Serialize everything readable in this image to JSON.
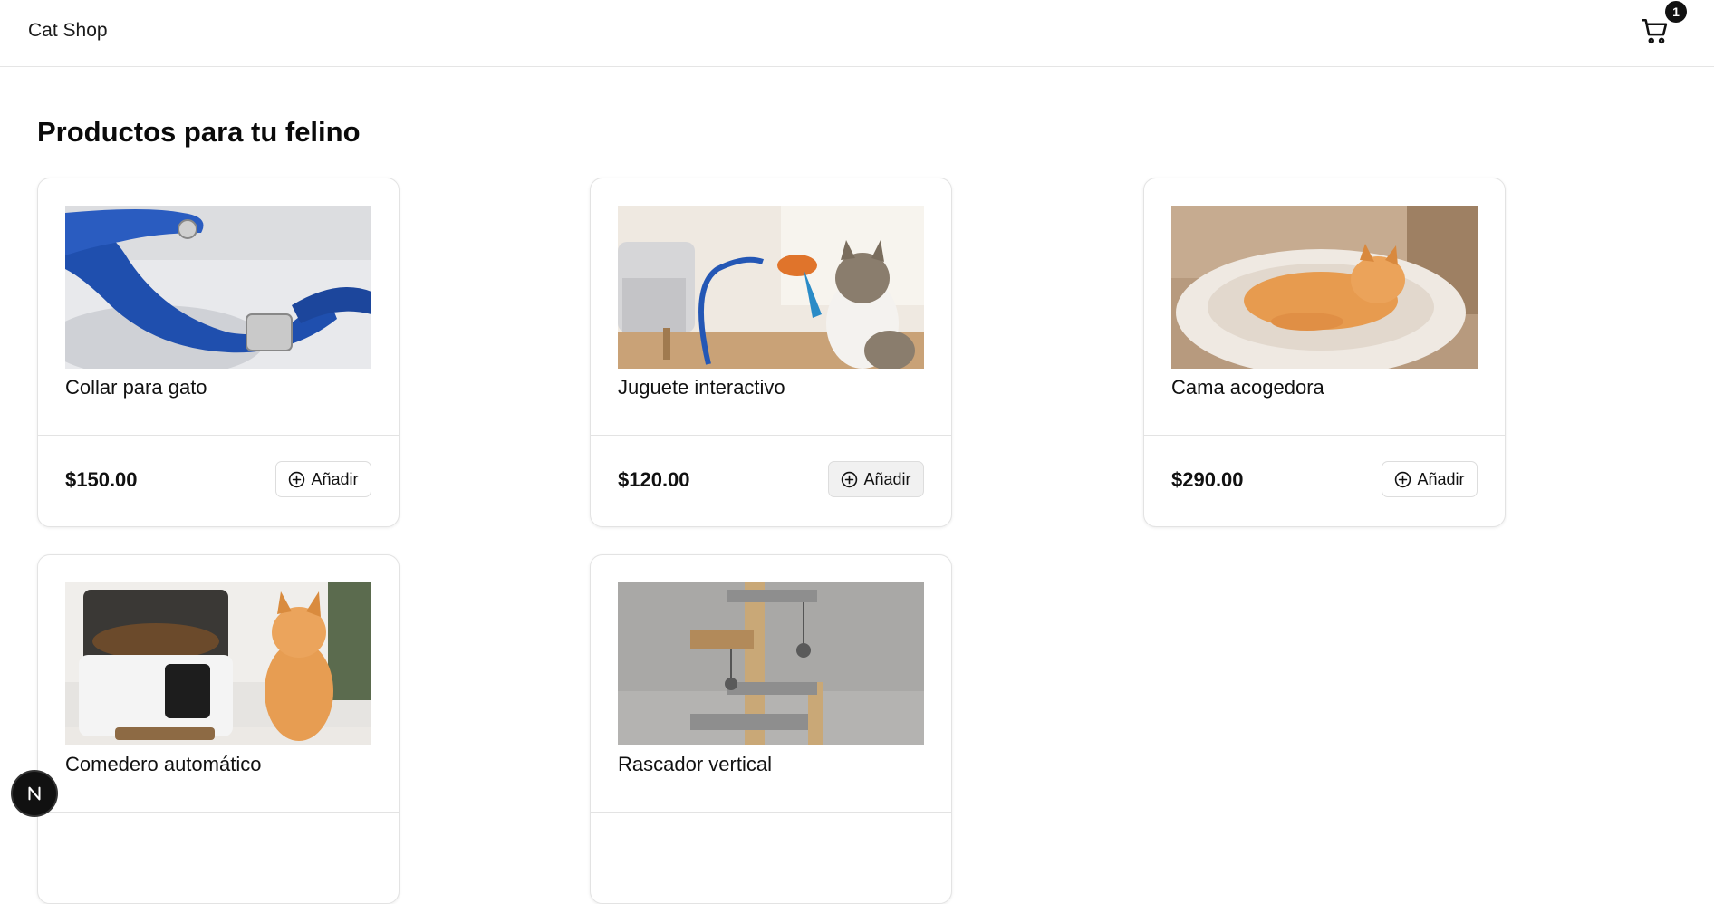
{
  "header": {
    "brand": "Cat Shop",
    "cart_icon": "shopping-cart-icon",
    "cart_count": "1"
  },
  "main": {
    "title": "Productos para tu felino",
    "products": [
      {
        "name": "Collar para gato",
        "price": "$150.00",
        "add_label": "Añadir",
        "image": "blue-cat-collar-photo"
      },
      {
        "name": "Juguete interactivo",
        "price": "$120.00",
        "add_label": "Añadir",
        "image": "cat-playing-feather-toy-photo"
      },
      {
        "name": "Cama acogedora",
        "price": "$290.00",
        "add_label": "Añadir",
        "image": "orange-cat-in-round-bed-photo"
      },
      {
        "name": "Comedero automático",
        "price": "",
        "add_label": "",
        "image": "automatic-feeder-with-cat-photo"
      },
      {
        "name": "Rascador vertical",
        "price": "",
        "add_label": "",
        "image": "cat-tree-scratcher-photo"
      }
    ]
  },
  "fab": {
    "icon": "next-logo-icon",
    "letter": "N"
  },
  "colors": {
    "text": "#111111",
    "border": "#e3e3e3",
    "badge_bg": "#111111",
    "badge_text": "#ffffff"
  }
}
